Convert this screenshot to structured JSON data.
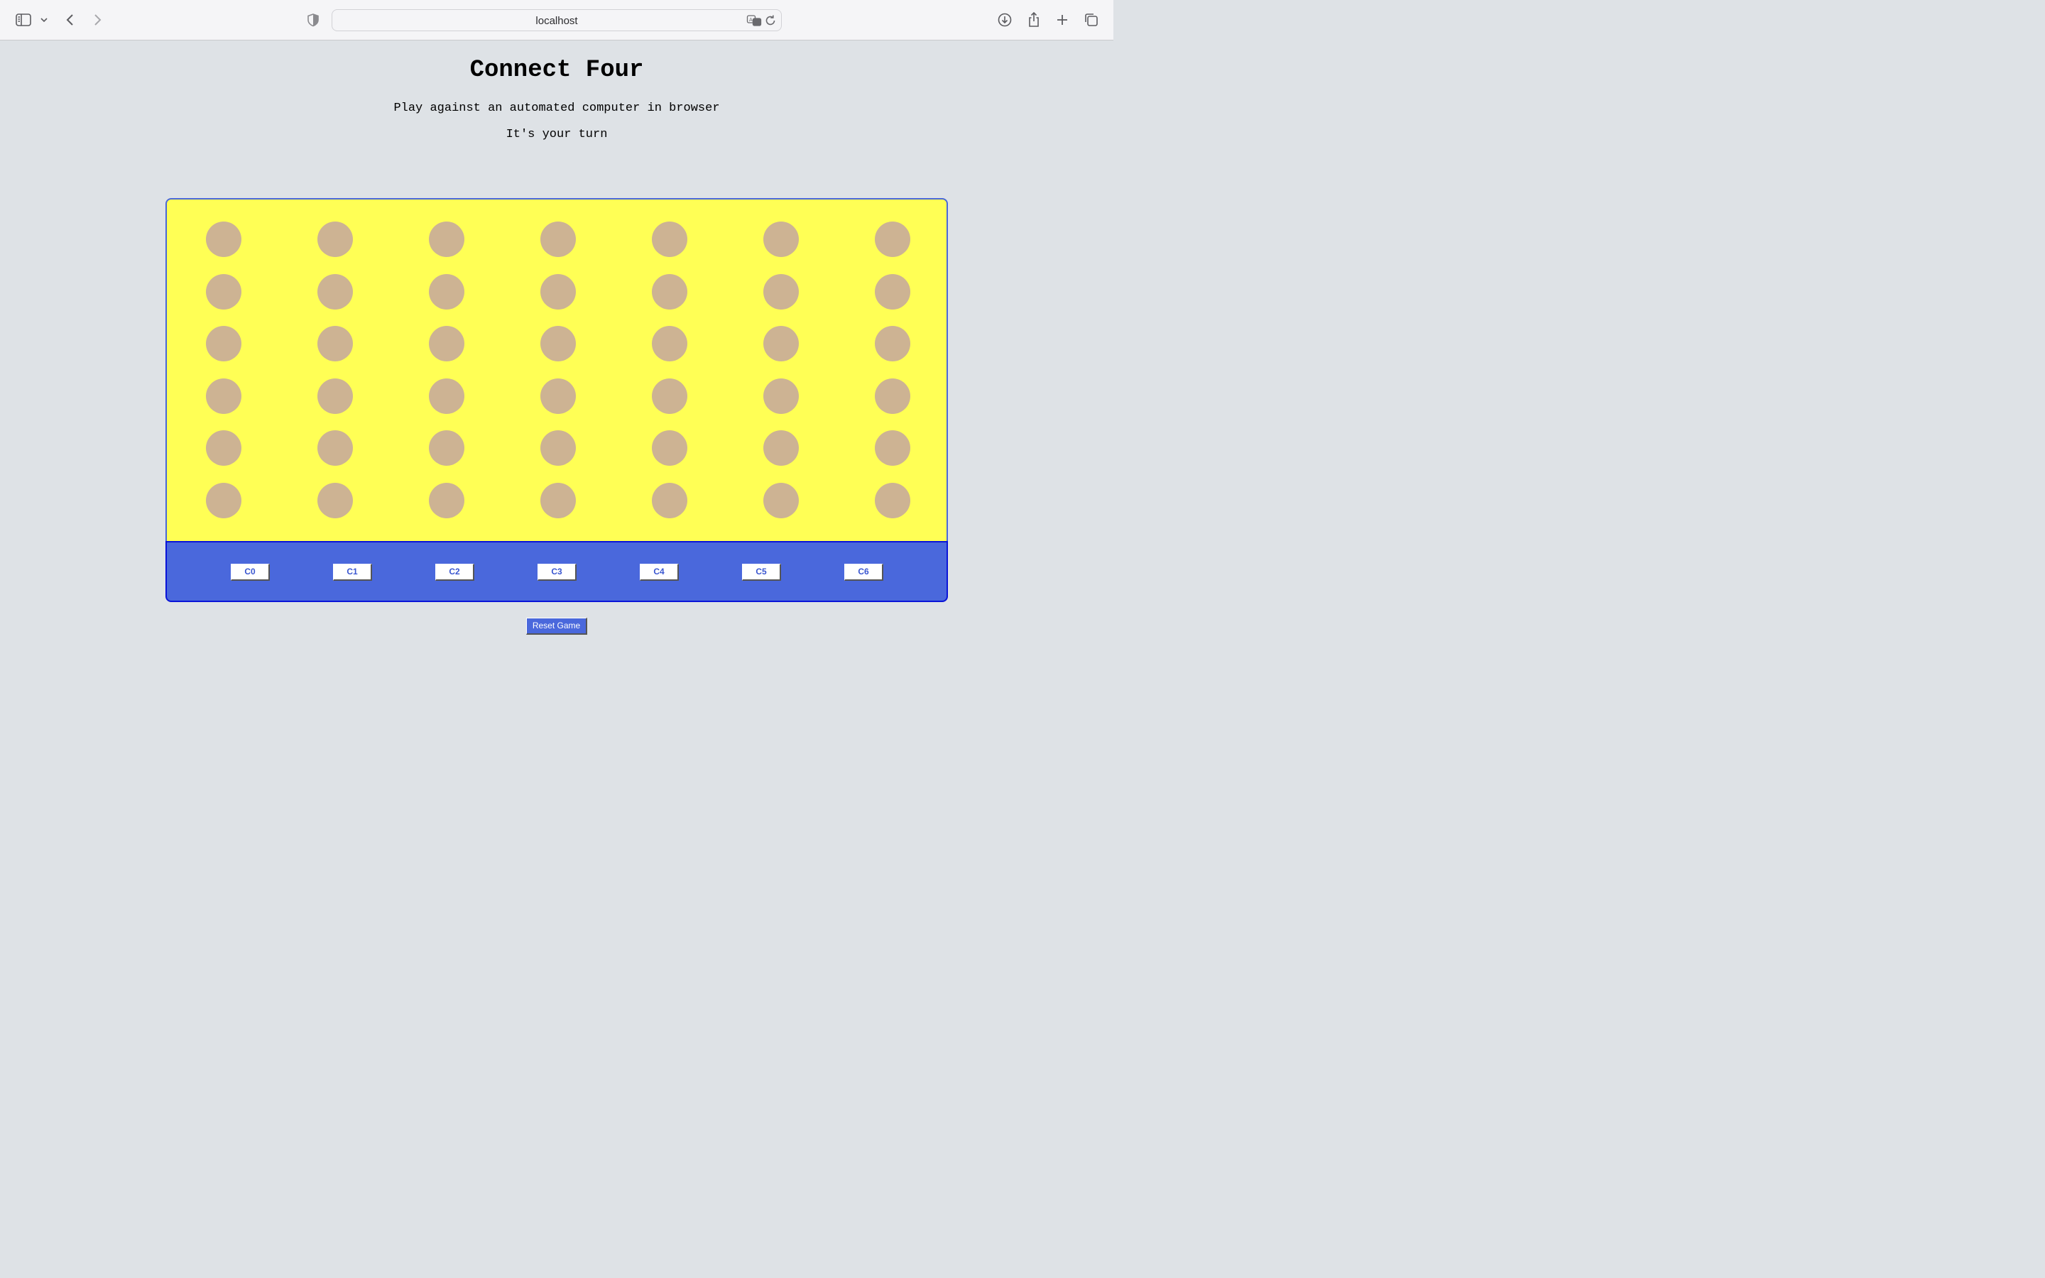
{
  "browser": {
    "url": "localhost",
    "icons": {
      "sidebar": "sidebar-toggle-icon",
      "tab_group_menu": "chevron-down-icon",
      "back": "back-arrow-icon",
      "forward": "forward-arrow-icon",
      "privacy": "shield-icon",
      "translate": "translate-icon",
      "reload": "reload-icon",
      "downloads": "download-icon",
      "share": "share-icon",
      "new_tab": "plus-icon",
      "tab_overview": "tab-overview-icon"
    }
  },
  "page": {
    "title": "Connect Four",
    "subtitle": "Play against an automated computer in browser",
    "status": "It's your turn"
  },
  "board": {
    "rows": 6,
    "columns": 7,
    "cells": [
      [
        "empty",
        "empty",
        "empty",
        "empty",
        "empty",
        "empty",
        "empty"
      ],
      [
        "empty",
        "empty",
        "empty",
        "empty",
        "empty",
        "empty",
        "empty"
      ],
      [
        "empty",
        "empty",
        "empty",
        "empty",
        "empty",
        "empty",
        "empty"
      ],
      [
        "empty",
        "empty",
        "empty",
        "empty",
        "empty",
        "empty",
        "empty"
      ],
      [
        "empty",
        "empty",
        "empty",
        "empty",
        "empty",
        "empty",
        "empty"
      ],
      [
        "empty",
        "empty",
        "empty",
        "empty",
        "empty",
        "empty",
        "empty"
      ]
    ],
    "column_buttons": [
      "C0",
      "C1",
      "C2",
      "C3",
      "C4",
      "C5",
      "C6"
    ],
    "colors": {
      "board": "#ffff55",
      "empty_slot": "#cdb393",
      "controls": "#4a68dc"
    }
  },
  "actions": {
    "reset_label": "Reset Game"
  }
}
